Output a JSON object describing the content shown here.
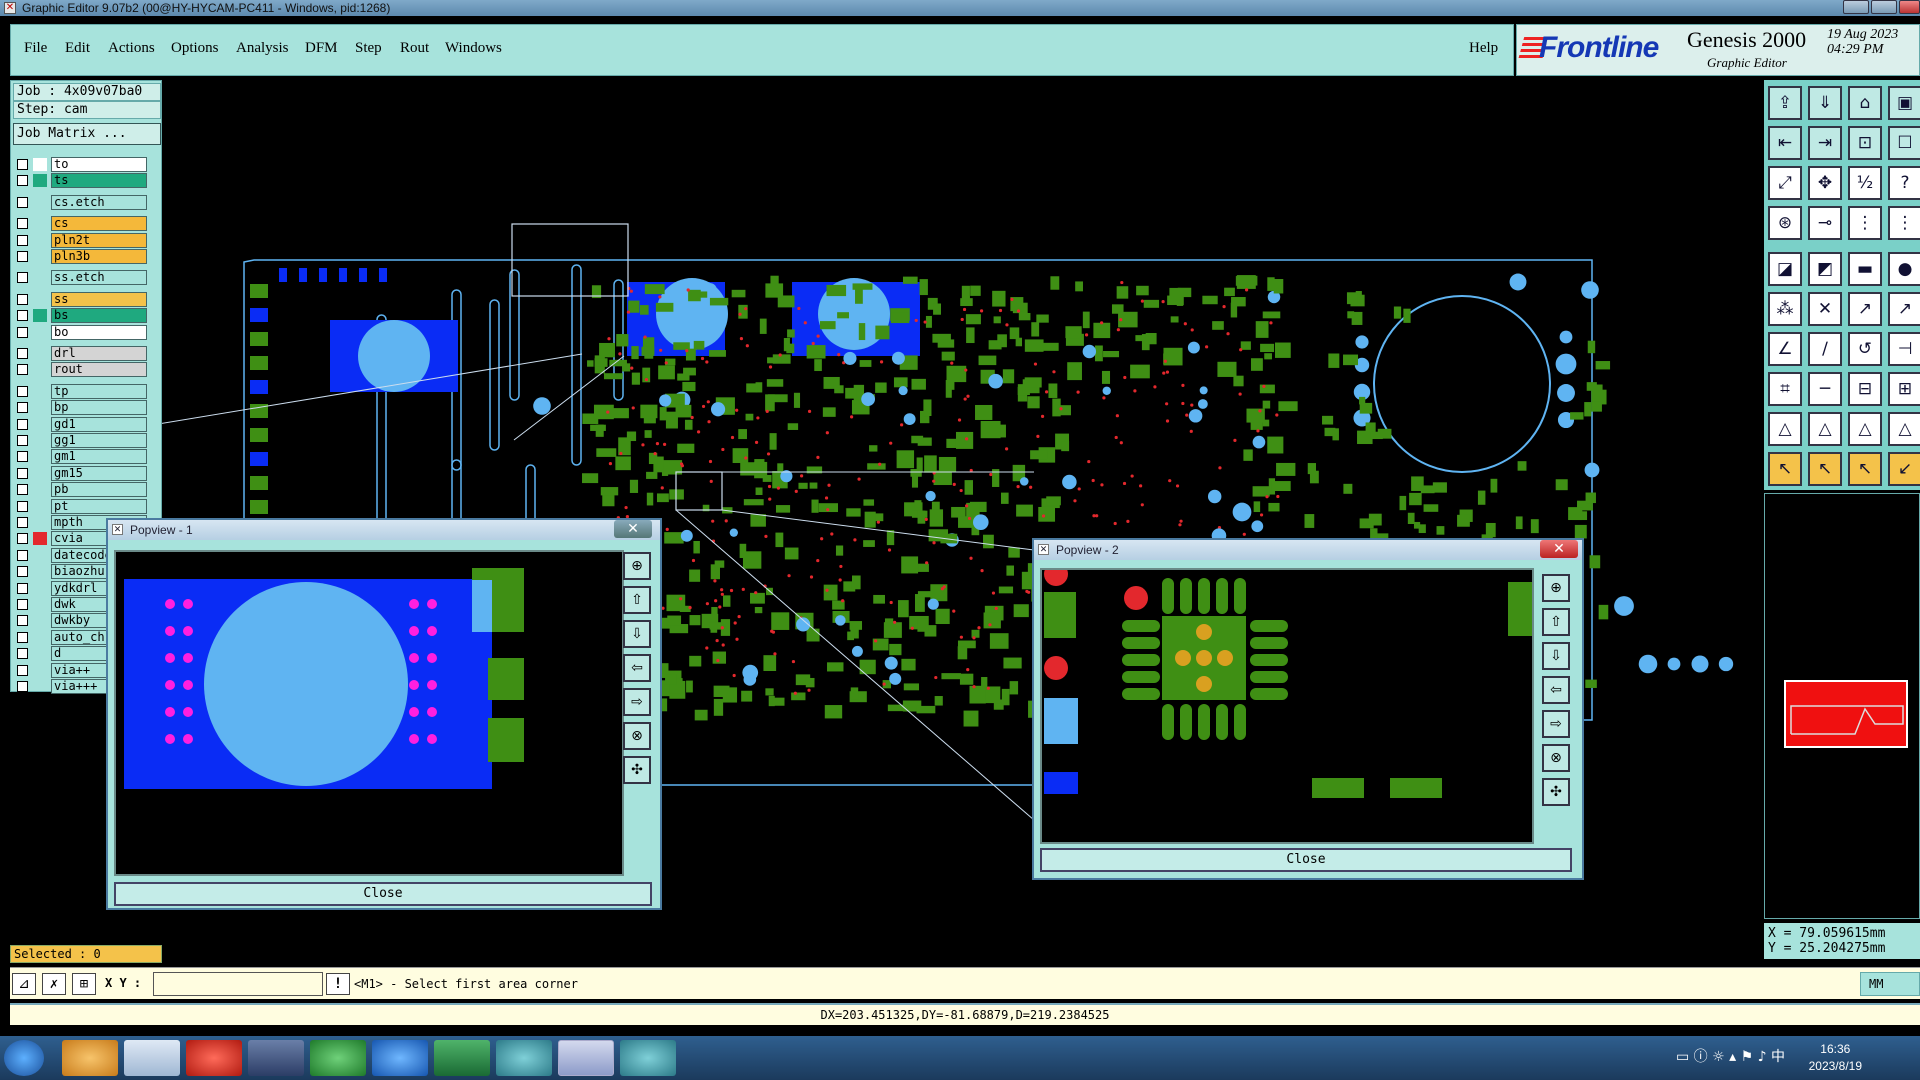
{
  "window": {
    "title": "Graphic Editor 9.07b2 (00@HY-HYCAM-PC411 - Windows, pid:1268)"
  },
  "menu": {
    "items": [
      "File",
      "Edit",
      "Actions",
      "Options",
      "Analysis",
      "DFM",
      "Step",
      "Rout",
      "Windows"
    ],
    "help": "Help"
  },
  "brand": {
    "logo": "Frontline",
    "product": "Genesis 2000",
    "subtitle": "Graphic Editor",
    "date": "19 Aug 2023",
    "time": "04:29 PM"
  },
  "job": {
    "job_label": "Job : 4x09v07ba0",
    "step_label": "Step: cam",
    "matrix_button": "Job Matrix ..."
  },
  "layers": [
    {
      "name": "to",
      "color": "#ffffff",
      "ind": "#ffffff"
    },
    {
      "name": "ts",
      "color": "#1fa97f",
      "ind": "#1fa97f"
    },
    {
      "name": "cs.etch",
      "color": "#a7e3dc",
      "ind": ""
    },
    {
      "name": "cs",
      "color": "#f4b83a",
      "ind": ""
    },
    {
      "name": "pln2t",
      "color": "#f4b83a",
      "ind": ""
    },
    {
      "name": "pln3b",
      "color": "#f4b83a",
      "ind": ""
    },
    {
      "name": "ss.etch",
      "color": "#a7e3dc",
      "ind": ""
    },
    {
      "name": "ss",
      "color": "#f4c24a",
      "ind": ""
    },
    {
      "name": "bs",
      "color": "#1fa97f",
      "ind": "#1fa97f"
    },
    {
      "name": "bo",
      "color": "#ffffff",
      "ind": ""
    },
    {
      "name": "drl",
      "color": "#d4d4d4",
      "ind": ""
    },
    {
      "name": "rout",
      "color": "#d4d4d4",
      "ind": ""
    },
    {
      "name": "tp",
      "color": "#a7e3dc",
      "ind": ""
    },
    {
      "name": "bp",
      "color": "#a7e3dc",
      "ind": ""
    },
    {
      "name": "gd1",
      "color": "#a7e3dc",
      "ind": ""
    },
    {
      "name": "gg1",
      "color": "#a7e3dc",
      "ind": ""
    },
    {
      "name": "gm1",
      "color": "#a7e3dc",
      "ind": ""
    },
    {
      "name": "gm15",
      "color": "#a7e3dc",
      "ind": ""
    },
    {
      "name": "pb",
      "color": "#a7e3dc",
      "ind": ""
    },
    {
      "name": "pt",
      "color": "#a7e3dc",
      "ind": ""
    },
    {
      "name": "mpth",
      "color": "#a7e3dc",
      "ind": ""
    },
    {
      "name": "cvia",
      "color": "#a7e3dc",
      "ind": "#e3282d"
    },
    {
      "name": "datecode",
      "color": "#a7e3dc",
      "ind": ""
    },
    {
      "name": "biaozhu",
      "color": "#a7e3dc",
      "ind": ""
    },
    {
      "name": "ydkdrl",
      "color": "#a7e3dc",
      "ind": ""
    },
    {
      "name": "dwk",
      "color": "#a7e3dc",
      "ind": ""
    },
    {
      "name": "dwkby",
      "color": "#a7e3dc",
      "ind": ""
    },
    {
      "name": "auto_chk",
      "color": "#a7e3dc",
      "ind": ""
    },
    {
      "name": "d",
      "color": "#a7e3dc",
      "ind": ""
    },
    {
      "name": "via++",
      "color": "#a7e3dc",
      "ind": ""
    },
    {
      "name": "via+++",
      "color": "#a7e3dc",
      "ind": ""
    }
  ],
  "selected": "Selected : 0",
  "coords": {
    "x": "X = 79.059615mm",
    "y": "Y = 25.204275mm"
  },
  "command": {
    "xy_label": "X Y :",
    "xy_value": "",
    "message": "<M1> - Select first area corner",
    "units": "MM"
  },
  "status": "DX=203.451325,DY=-81.68879,D=219.2384525",
  "popups": [
    {
      "title": "Popview - 1",
      "close_label": "Close"
    },
    {
      "title": "Popview - 2",
      "close_label": "Close"
    }
  ],
  "taskbar": {
    "time": "16:36",
    "date": "2023/8/19"
  },
  "colors": {
    "panel": "#a7e3dc",
    "pad": "#3f8f14",
    "via": "#5fb4f2",
    "plane": "#0a2cf5",
    "drill": "#e3282d",
    "pin": "#ff1fe0"
  }
}
